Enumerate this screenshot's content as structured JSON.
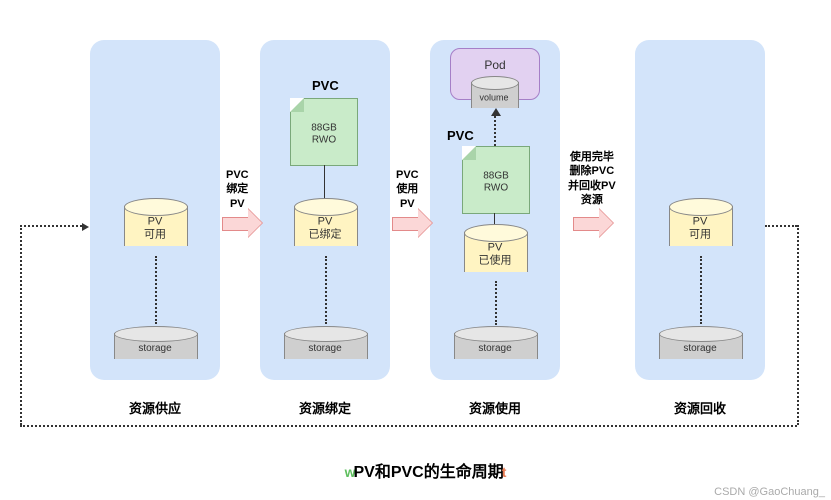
{
  "panels": {
    "p1": {
      "pv": "PV\n可用",
      "storage": "storage",
      "stage": "资源供应"
    },
    "p2": {
      "pvc_title": "PVC",
      "pvc_spec": "88GB\nRWO",
      "pv": "PV\n已绑定",
      "storage": "storage",
      "stage": "资源绑定"
    },
    "p3": {
      "pod": "Pod",
      "volume": "volume",
      "pvc_title": "PVC",
      "pvc_spec": "88GB\nRWO",
      "pv": "PV\n已使用",
      "storage": "storage",
      "stage": "资源使用"
    },
    "p4": {
      "pv": "PV\n可用",
      "storage": "storage",
      "stage": "资源回收"
    }
  },
  "arrows": {
    "a1": "PVC\n绑定\nPV",
    "a2": "PVC\n使用\nPV",
    "a3": "使用完毕\n删除PVC\n并回收PV\n资源"
  },
  "title": "PV和PVC的生命周期",
  "credit": "CSDN @GaoChuang_"
}
